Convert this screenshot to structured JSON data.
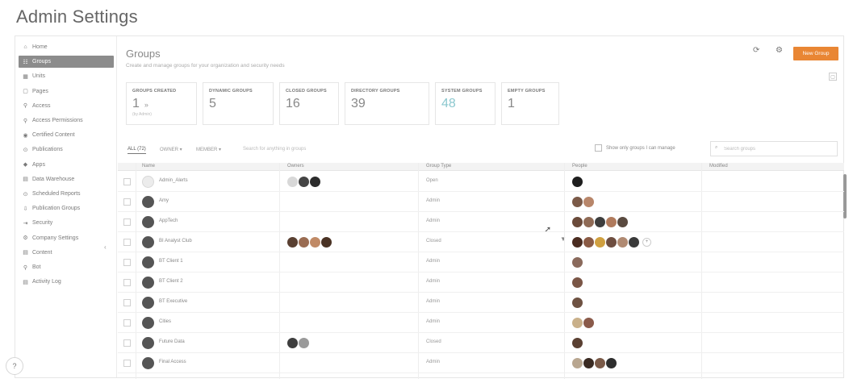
{
  "page_title": "Admin Settings",
  "sidebar": {
    "items": [
      {
        "icon": "⌂",
        "icon_name": "home-icon",
        "label": "Home"
      },
      {
        "icon": "☷",
        "icon_name": "groups-icon",
        "label": "Groups"
      },
      {
        "icon": "▦",
        "icon_name": "units-icon",
        "label": "Units"
      },
      {
        "icon": "▢",
        "icon_name": "pages-icon",
        "label": "Pages"
      },
      {
        "icon": "⚲",
        "icon_name": "access-icon",
        "label": "Access"
      },
      {
        "icon": "⚲",
        "icon_name": "access-permissions-icon",
        "label": "Access Permissions"
      },
      {
        "icon": "◉",
        "icon_name": "certified-content-icon",
        "label": "Certified Content"
      },
      {
        "icon": "⊙",
        "icon_name": "publications-icon",
        "label": "Publications"
      },
      {
        "icon": "◆",
        "icon_name": "apps-icon",
        "label": "Apps"
      },
      {
        "icon": "▤",
        "icon_name": "data-warehouse-icon",
        "label": "Data Warehouse"
      },
      {
        "icon": "⊙",
        "icon_name": "scheduled-reports-icon",
        "label": "Scheduled Reports"
      },
      {
        "icon": "⇩",
        "icon_name": "publication-groups-icon",
        "label": "Publication Groups"
      },
      {
        "icon": "⇥",
        "icon_name": "security-icon",
        "label": "Security"
      },
      {
        "icon": "⚙",
        "icon_name": "company-settings-icon",
        "label": "Company Settings"
      },
      {
        "icon": "▤",
        "icon_name": "content-icon",
        "label": "Content"
      },
      {
        "icon": "⚲",
        "icon_name": "bot-icon",
        "label": "Bot"
      },
      {
        "icon": "▤",
        "icon_name": "activity-log-icon",
        "label": "Activity Log"
      }
    ],
    "active_index": 1,
    "collapse_glyph": "‹",
    "help_label": "?"
  },
  "main": {
    "title": "Groups",
    "subtitle": "Create and manage groups for your organization and security needs",
    "refresh_glyph": "⟳",
    "settings_glyph": "⚙",
    "new_group_label": "New Group",
    "panel_toggle_glyph": "▢"
  },
  "stats": [
    {
      "label": "GROUPS CREATED",
      "value": "1",
      "arrow": "»",
      "sub": "(by Admin)"
    },
    {
      "label": "DYNAMIC GROUPS",
      "value": "5",
      "arrow": "",
      "sub": ""
    },
    {
      "label": "CLOSED GROUPS",
      "value": "16",
      "arrow": "",
      "sub": ""
    },
    {
      "label": "DIRECTORY GROUPS",
      "value": "39",
      "arrow": "",
      "sub": ""
    },
    {
      "label": "SYSTEM GROUPS",
      "value": "48",
      "arrow": "",
      "sub": ""
    },
    {
      "label": "EMPTY GROUPS",
      "value": "1",
      "arrow": "",
      "sub": ""
    }
  ],
  "filters": {
    "tabs": [
      "ALL (72)",
      "OWNER ▾",
      "MEMBER ▾"
    ],
    "active_tab": 0,
    "search_hint": "Search for anything in groups",
    "only_mine_label": "Show only groups I can manage",
    "search_glyph": "⌕",
    "search_placeholder": "Search groups"
  },
  "table": {
    "columns": [
      "Name",
      "Owners",
      "Group Type",
      "People",
      "Modified"
    ],
    "rows": [
      {
        "name": "Admin_Alerts",
        "avatar_style": "light",
        "type": "Open",
        "owners": [
          "#d8d8d8",
          "#444444",
          "#2c2c2c"
        ],
        "people": [
          "#1e1e1e"
        ],
        "more": ""
      },
      {
        "name": "Amy",
        "avatar_style": "dark",
        "type": "Admin",
        "owners": [],
        "people": [
          "#7b5a48",
          "#b8866a"
        ],
        "more": ""
      },
      {
        "name": "AppTech",
        "avatar_style": "dark",
        "type": "Admin",
        "owners": [],
        "people": [
          "#6a4a3a",
          "#8f6a55",
          "#3e3e3e",
          "#b07a5c",
          "#5a4a40"
        ],
        "more": ""
      },
      {
        "name": "BI Analyst Club",
        "avatar_style": "dark",
        "type": "Closed",
        "owners": [
          "#5a4032",
          "#9a6c52",
          "#c08a66",
          "#4a3224"
        ],
        "people": [
          "#4a2c20",
          "#8a5a44",
          "#d0a040",
          "#6e4e40",
          "#b08a72",
          "#3a3a3a"
        ],
        "more": "+"
      },
      {
        "name": "BT Client 1",
        "avatar_style": "dark",
        "type": "Admin",
        "owners": [],
        "people": [
          "#8a6a5c"
        ],
        "more": ""
      },
      {
        "name": "BT Client 2",
        "avatar_style": "dark",
        "type": "Admin",
        "owners": [],
        "people": [
          "#7a5646"
        ],
        "more": ""
      },
      {
        "name": "BT Executive",
        "avatar_style": "dark",
        "type": "Admin",
        "owners": [],
        "people": [
          "#6e5242"
        ],
        "more": ""
      },
      {
        "name": "Cities",
        "avatar_style": "dark",
        "type": "Admin",
        "owners": [],
        "people": [
          "#c9b08a",
          "#8a5a4a"
        ],
        "more": ""
      },
      {
        "name": "Future Data",
        "avatar_style": "dark",
        "type": "Closed",
        "owners": [
          "#3e3e3e",
          "#9a9a9a"
        ],
        "people": [
          "#5a4032"
        ],
        "more": ""
      },
      {
        "name": "Final Access",
        "avatar_style": "dark",
        "type": "Admin",
        "owners": [],
        "people": [
          "#b8a690",
          "#3a2a22",
          "#7a5a48",
          "#2e2e2e"
        ],
        "more": ""
      }
    ]
  }
}
